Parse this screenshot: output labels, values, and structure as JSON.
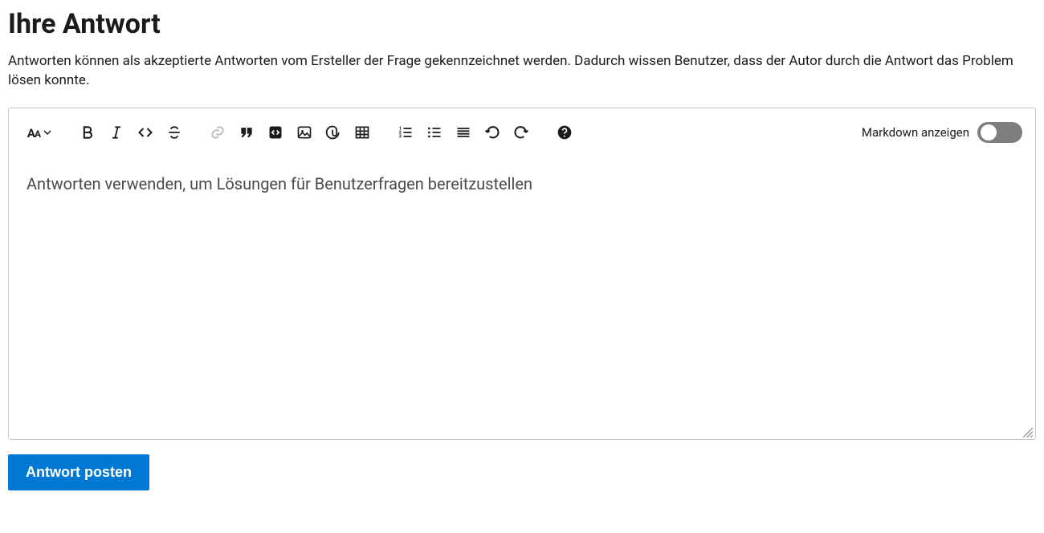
{
  "heading": "Ihre Antwort",
  "description": "Antworten können als akzeptierte Antworten vom Ersteller der Frage gekennzeichnet werden. Dadurch wissen Benutzer, dass der Autor durch die Antwort das Problem lösen konnte.",
  "toolbar": {
    "markdown_toggle_label": "Markdown anzeigen",
    "markdown_toggle_on": false
  },
  "editor": {
    "placeholder": "Antworten verwenden, um Lösungen für Benutzerfragen bereitzustellen",
    "value": ""
  },
  "buttons": {
    "post": "Antwort posten"
  },
  "icons": {
    "font_size": "font-size",
    "bold": "bold",
    "italic": "italic",
    "code_inline": "code",
    "strikethrough": "strikethrough",
    "link": "link",
    "quote": "quote",
    "code_block": "code-block",
    "image": "image",
    "attachment": "attachment",
    "table": "table",
    "ordered_list": "ordered-list",
    "unordered_list": "unordered-list",
    "align": "align",
    "undo": "undo",
    "redo": "redo",
    "help": "help"
  }
}
